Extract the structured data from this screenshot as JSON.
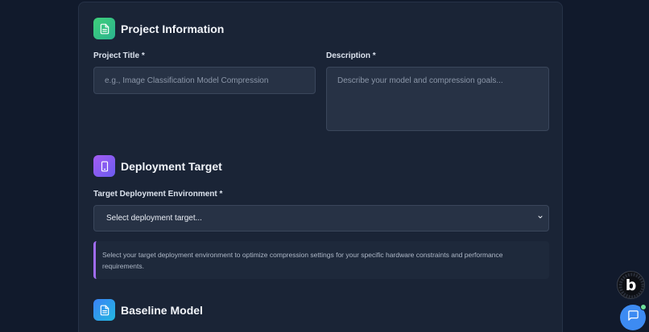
{
  "sections": {
    "project_info": {
      "title": "Project Information",
      "icon": "document-icon",
      "title_label": "Project Title *",
      "title_placeholder": "e.g., Image Classification Model Compression",
      "description_label": "Description *",
      "description_placeholder": "Describe your model and compression goals..."
    },
    "deployment": {
      "title": "Deployment Target",
      "icon": "phone-icon",
      "env_label": "Target Deployment Environment *",
      "select_value": "Select deployment target...",
      "info_text": "Select your target deployment environment to optimize compression settings for your specific hardware constraints and performance requirements."
    },
    "baseline": {
      "title": "Baseline Model",
      "icon": "document-icon"
    }
  },
  "widgets": {
    "badge_letter": "b",
    "badge_ring_text": "POWERED BY BOLT.NEW",
    "chat_icon": "chat-bubble-icon"
  },
  "colors": {
    "background": "#111a2c",
    "card": "#1a2436",
    "accent_purple": "#a06cf0",
    "chat_blue": "#3d8bf2",
    "online_green": "#6ee09a"
  }
}
